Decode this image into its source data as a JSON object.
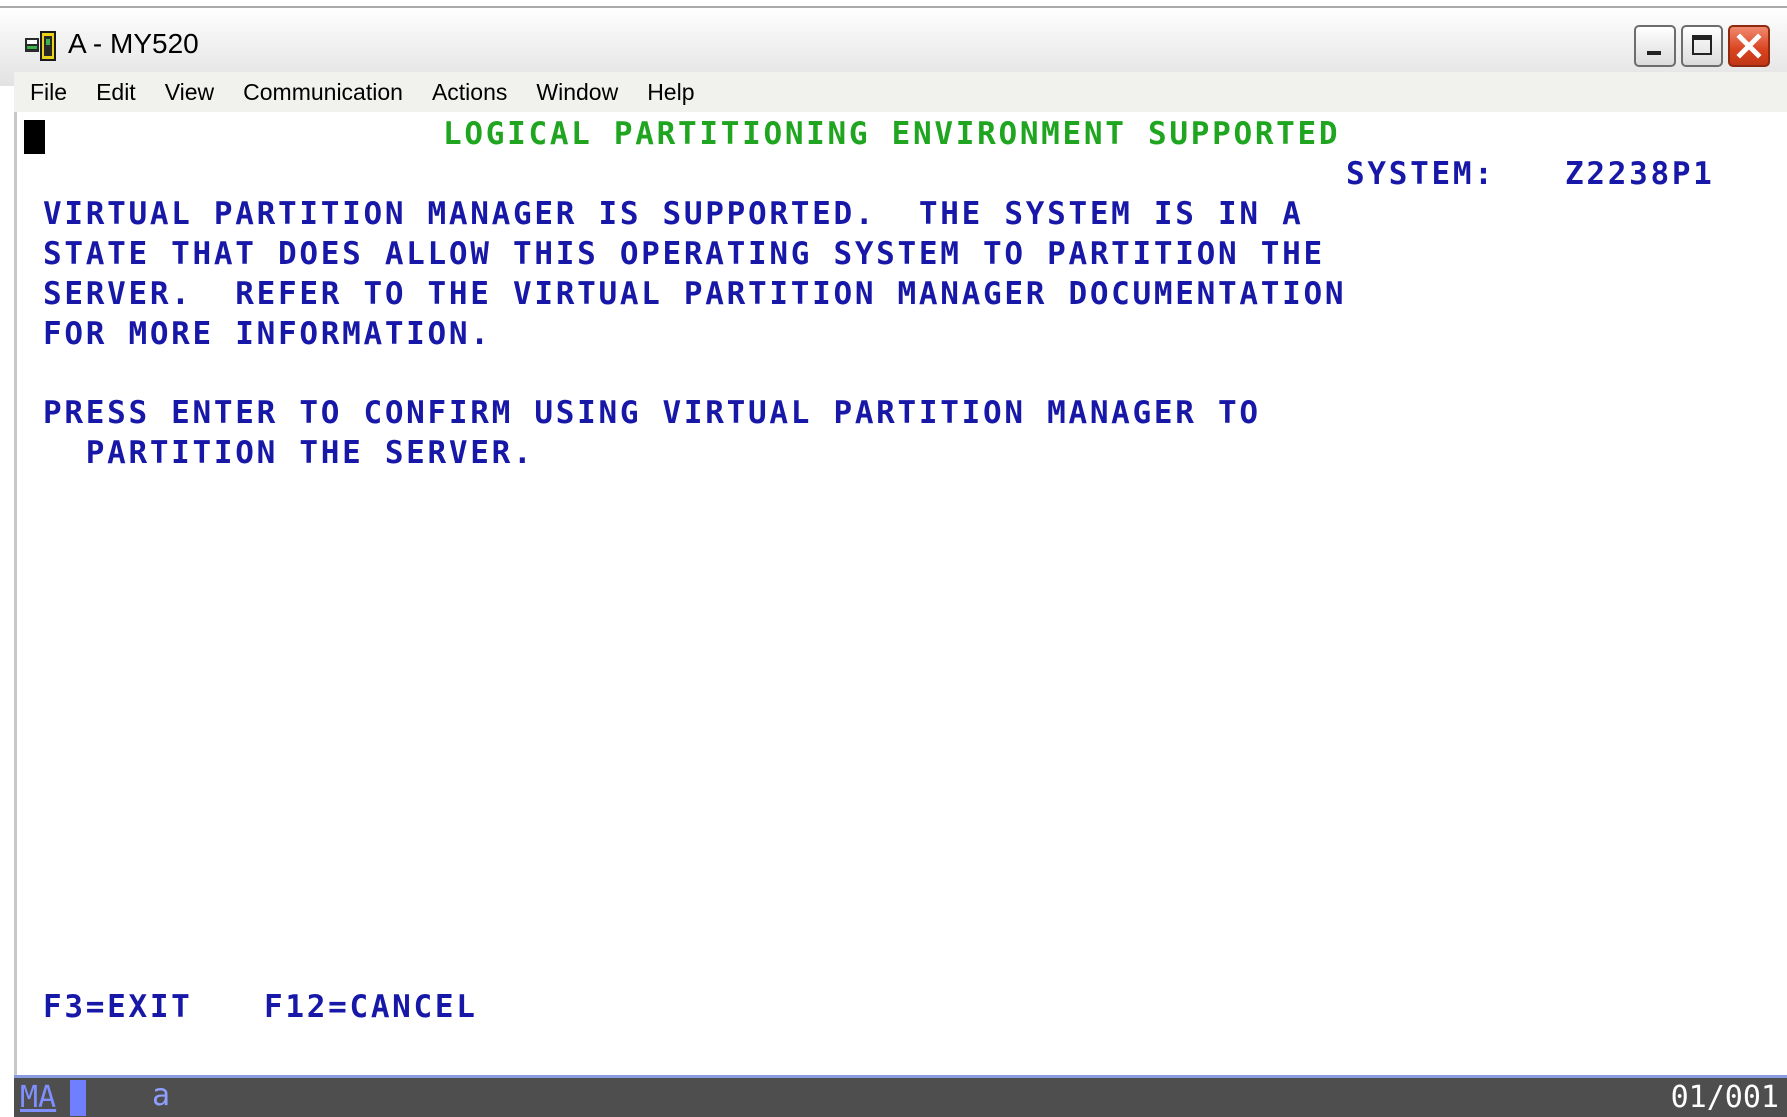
{
  "window": {
    "title": "A - MY520",
    "icon": "terminal-session-icon"
  },
  "menu": {
    "items": [
      "File",
      "Edit",
      "View",
      "Communication",
      "Actions",
      "Window",
      "Help"
    ]
  },
  "screen": {
    "header": "LOGICAL PARTITIONING ENVIRONMENT SUPPORTED",
    "system_label": "SYSTEM:",
    "system_value": "Z2238P1",
    "message_lines": [
      "VIRTUAL PARTITION MANAGER IS SUPPORTED.  THE SYSTEM IS IN A",
      "STATE THAT DOES ALLOW THIS OPERATING SYSTEM TO PARTITION THE",
      "SERVER.  REFER TO THE VIRTUAL PARTITION MANAGER DOCUMENTATION",
      "FOR MORE INFORMATION."
    ],
    "prompt_lines": [
      "PRESS ENTER TO CONFIRM USING VIRTUAL PARTITION MANAGER TO",
      "  PARTITION THE SERVER."
    ],
    "function_keys": {
      "f3": "F3=EXIT",
      "f12": "F12=CANCEL"
    },
    "colors": {
      "text": "#1818a8",
      "header": "#1fa51f"
    }
  },
  "status": {
    "mode": "MA",
    "indicator": "a",
    "cursor_position": "01/001"
  }
}
